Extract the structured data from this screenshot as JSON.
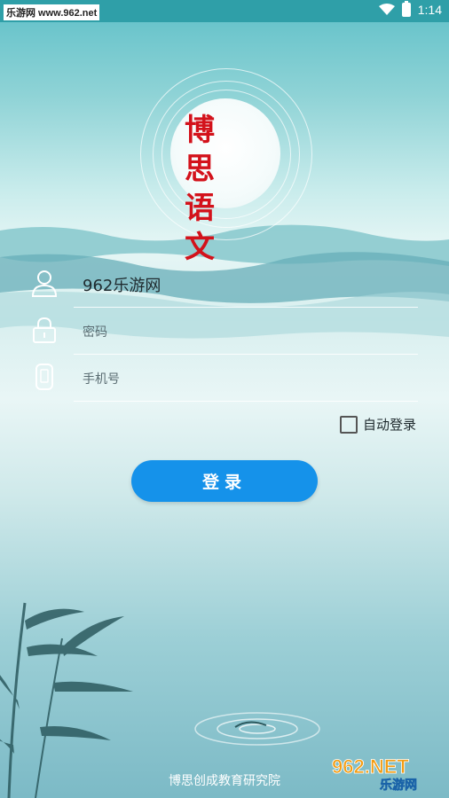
{
  "status": {
    "left_label": "乐游网 www.962.net",
    "time": "1:14"
  },
  "logo": {
    "line1": "博 思",
    "line2": "语 文"
  },
  "form": {
    "username_value": "962乐游网",
    "password_placeholder": "密码",
    "phone_placeholder": "手机号",
    "remember_label": "自动登录",
    "login_label": "登录"
  },
  "footer": {
    "org": "博思创成教育研究院"
  },
  "watermark": {
    "brand": "962.NET",
    "sub": "乐游网"
  },
  "colors": {
    "accent": "#1592ea",
    "logo_red": "#d3121b"
  }
}
